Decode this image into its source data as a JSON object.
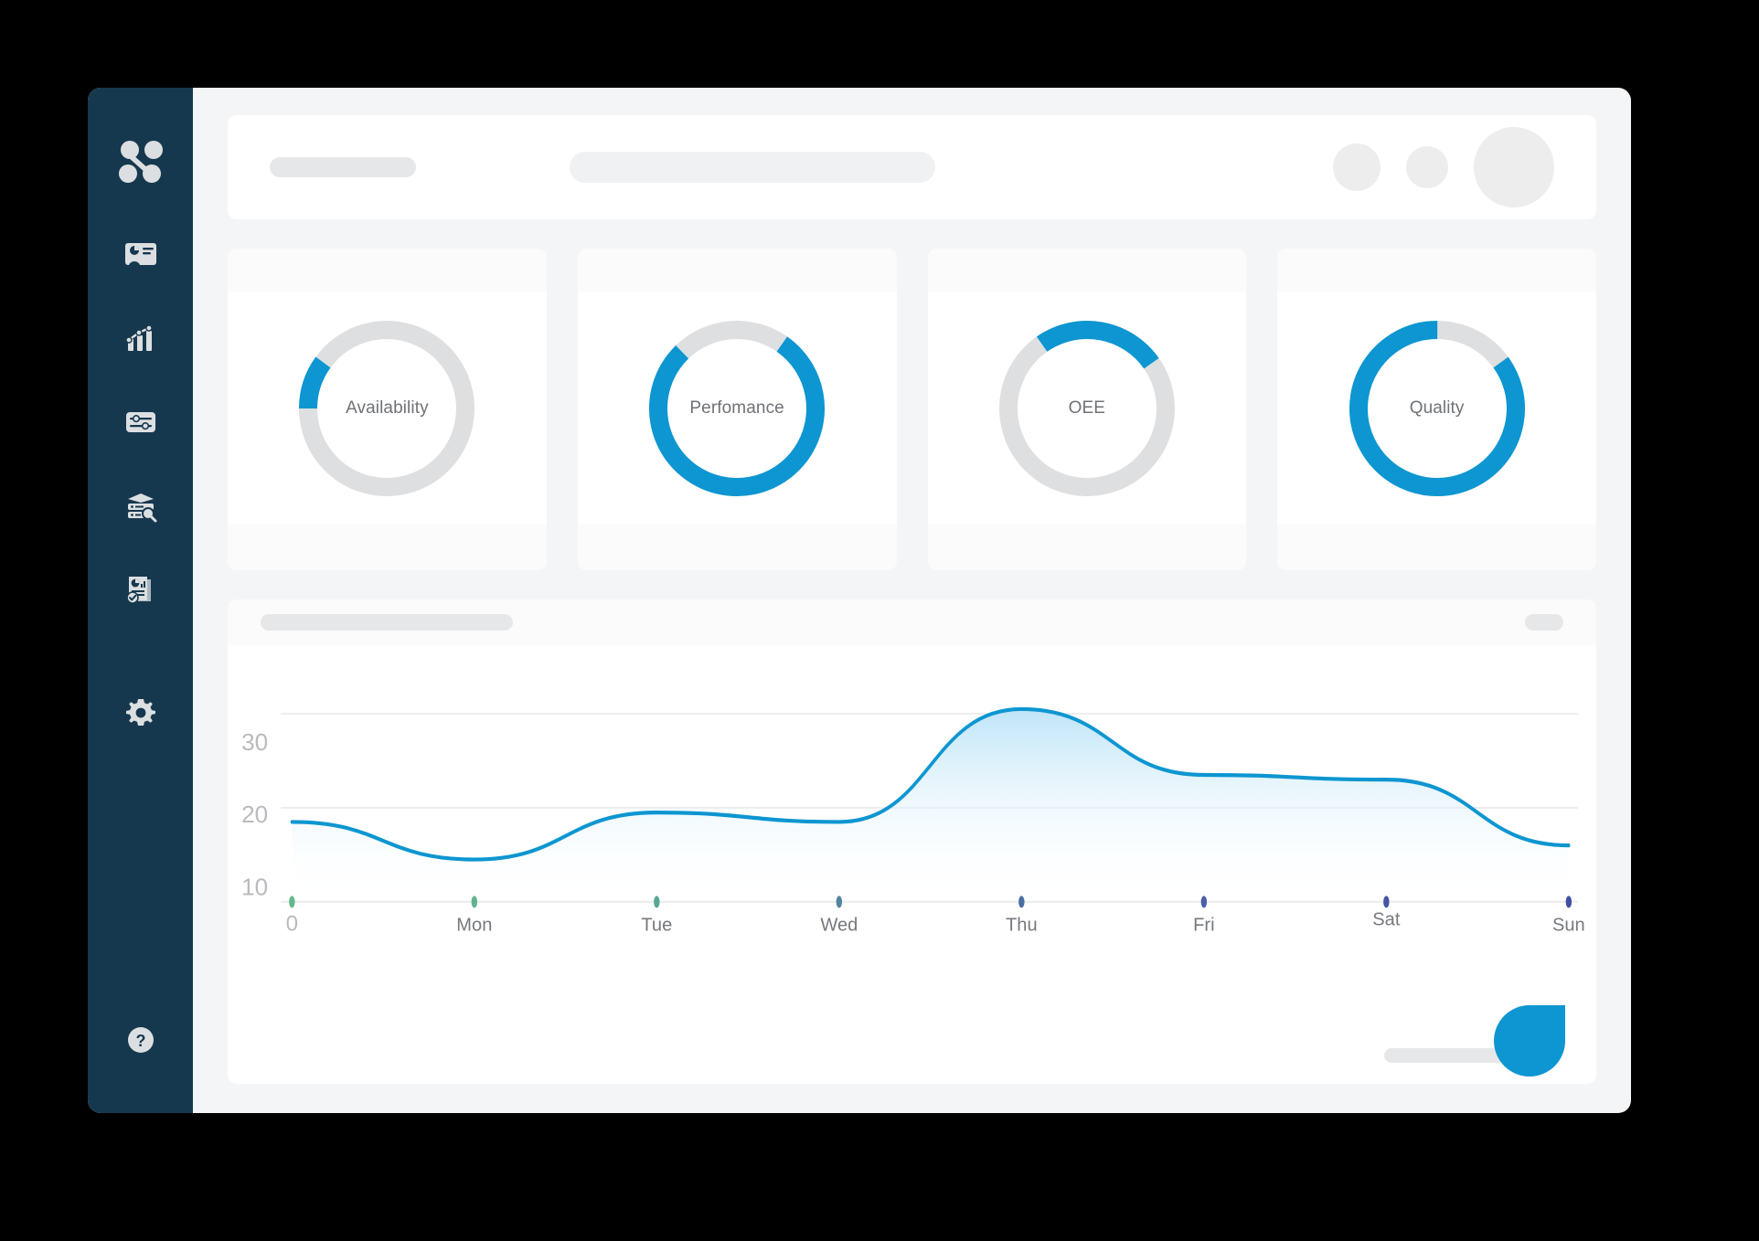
{
  "theme": {
    "accent": "#0d96d1",
    "sidebar_bg": "#16384f",
    "track": "#dedfe1",
    "canvas_bg": "#f4f5f7",
    "card_bg": "#ffffff",
    "label_text": "#6f7276",
    "axis_text": "#b9bbbe"
  },
  "sidebar": {
    "logo": "network-nodes-logo",
    "items": [
      {
        "icon": "id-card-dashboard-icon",
        "name": "sidebar-item-overview"
      },
      {
        "icon": "bar-line-chart-icon",
        "name": "sidebar-item-analytics"
      },
      {
        "icon": "sliders-settings-icon",
        "name": "sidebar-item-controls"
      },
      {
        "icon": "server-search-icon",
        "name": "sidebar-item-data"
      },
      {
        "icon": "report-check-icon",
        "name": "sidebar-item-reports"
      },
      {
        "icon": "gear-icon",
        "name": "sidebar-item-settings"
      }
    ],
    "help": {
      "icon": "question-circle-icon",
      "name": "sidebar-item-help"
    }
  },
  "topbar": {
    "title_placeholder": "",
    "search_placeholder": "",
    "actions": [
      "action-circle-1",
      "action-circle-2",
      "avatar"
    ]
  },
  "kpis": [
    {
      "label": "Availability",
      "value": 10,
      "name": "kpi-card-availability"
    },
    {
      "label": "Perfomance",
      "value": 78,
      "name": "kpi-card-perfomance"
    },
    {
      "label": "OEE",
      "value": 25,
      "name": "kpi-card-oee"
    },
    {
      "label": "Quality",
      "value": 85,
      "name": "kpi-card-quality"
    }
  ],
  "chart_data": {
    "type": "area",
    "title": "",
    "xlabel": "",
    "ylabel": "",
    "categories": [
      "0",
      "Mon",
      "Tue",
      "Wed",
      "Thu",
      "Fri",
      "Sat",
      "Sun"
    ],
    "values": [
      18.5,
      14.5,
      19.5,
      18.5,
      30.5,
      23.5,
      23,
      16
    ],
    "ytick_labels": [
      "30",
      "20",
      "10"
    ],
    "ytick_values": [
      30,
      20,
      10
    ],
    "ylim": [
      10,
      34
    ],
    "grid": true,
    "legend": "none",
    "line_color": "#0d96d1",
    "fill_top": "#bfe5f8",
    "fill_bottom": "#ffffff",
    "marker_colors": [
      "#63b98a",
      "#60b38d",
      "#5aa694",
      "#51859e",
      "#4a6ea3",
      "#4a5fa5",
      "#4456a4",
      "#3f4fa3"
    ]
  },
  "chart_card": {
    "title_placeholder": "",
    "badge_placeholder": "",
    "footer_placeholder": "",
    "fab_label": ""
  }
}
